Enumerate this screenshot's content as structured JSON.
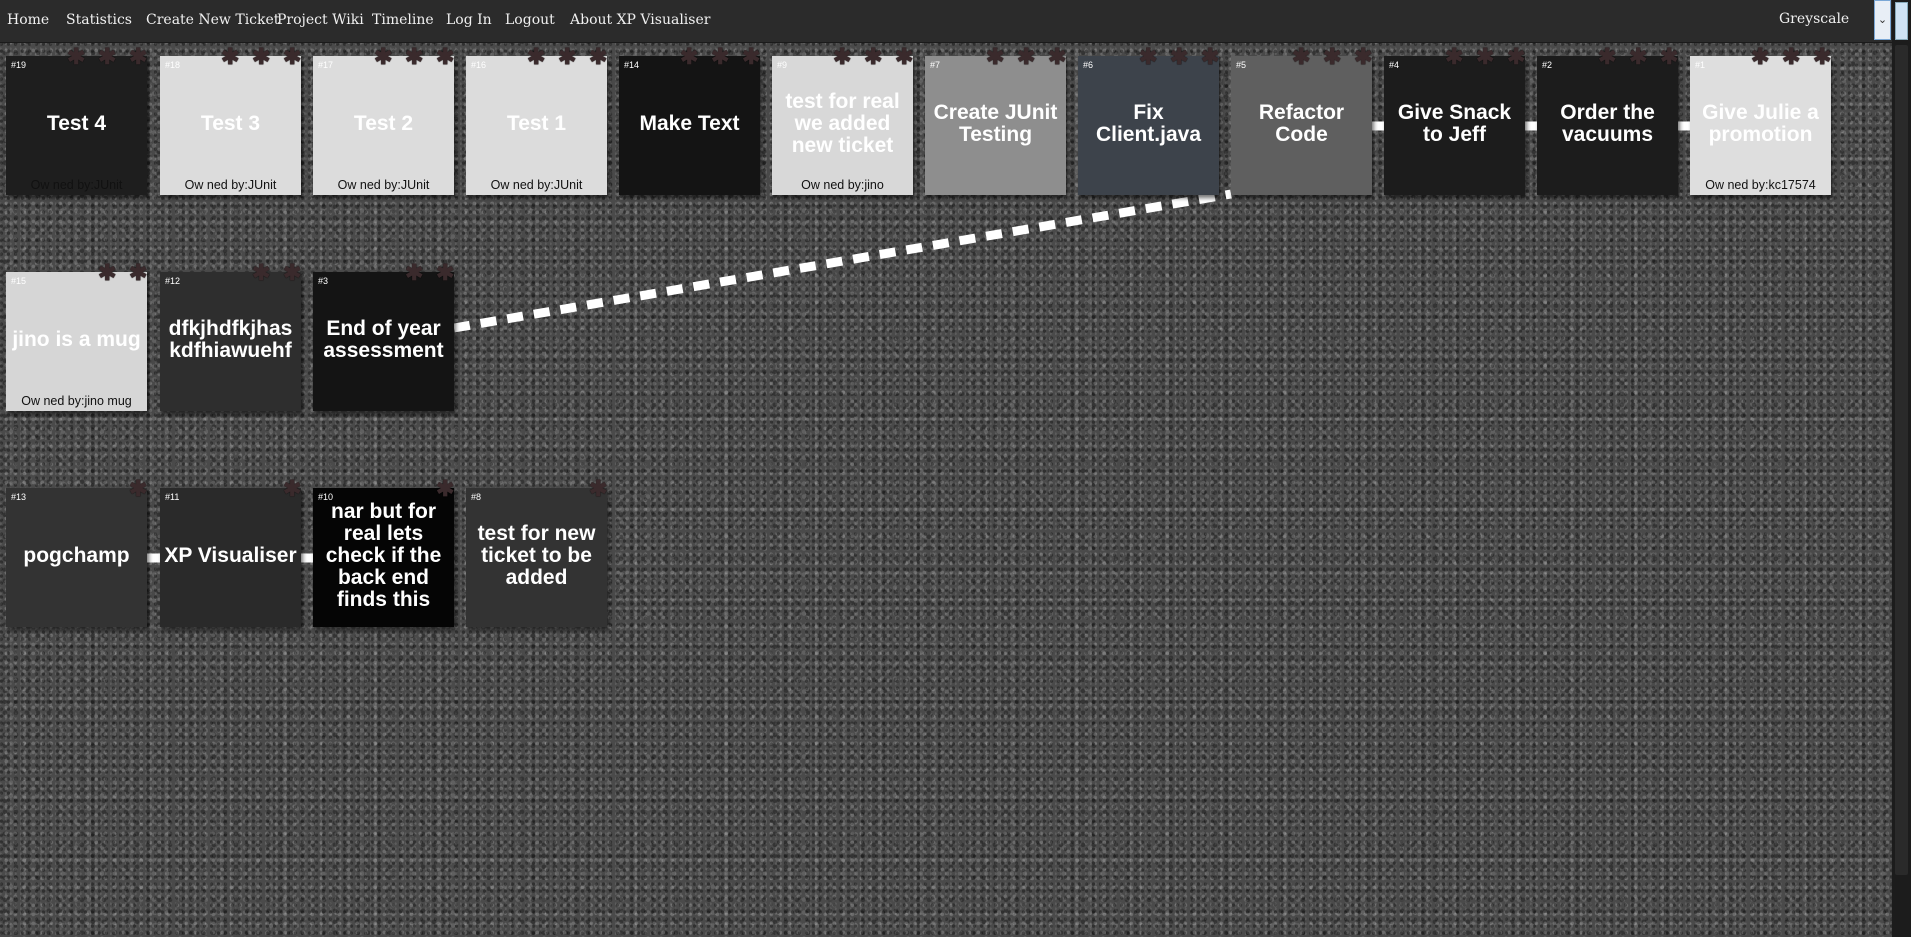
{
  "nav": {
    "items": [
      "Home",
      "Statistics",
      "Create New Ticket",
      "Project Wiki",
      "Timeline",
      "Log In",
      "Logout",
      "About XP Visualiser"
    ],
    "theme": {
      "selected": "Greyscale",
      "arrow": "⌄"
    }
  },
  "colors": {
    "navbar": "#2b2b2b",
    "link": "#ffffff",
    "pin": "#3a2a2c"
  },
  "tickets": [
    {
      "id": "#19",
      "title": "Test 4",
      "owner": "Ow ned by:JUnit",
      "color": "#1e1e1e",
      "owner_color": "#111111"
    },
    {
      "id": "#18",
      "title": "Test 3",
      "owner": "Ow ned by:JUnit",
      "color": "#dcdcdc",
      "owner_color": "#111111"
    },
    {
      "id": "#17",
      "title": "Test 2",
      "owner": "Ow ned by:JUnit",
      "color": "#dcdcdc",
      "owner_color": "#111111"
    },
    {
      "id": "#16",
      "title": "Test 1",
      "owner": "Ow ned by:JUnit",
      "color": "#dcdcdc",
      "owner_color": "#111111"
    },
    {
      "id": "#14",
      "title": "Make Text",
      "owner": "",
      "color": "#141414",
      "owner_color": "#111111"
    },
    {
      "id": "#9",
      "title": "test for real we added new ticket",
      "owner": "Ow ned by:jino",
      "color": "#d8d8d8",
      "owner_color": "#111111"
    },
    {
      "id": "#7",
      "title": "Create JUnit Testing",
      "owner": "",
      "color": "#8e8e8e",
      "owner_color": "#111111"
    },
    {
      "id": "#6",
      "title": "Fix Client.java",
      "owner": "",
      "color": "#3d434b",
      "owner_color": "#111111"
    },
    {
      "id": "#5",
      "title": "Refactor Code",
      "owner": "",
      "color": "#5f5f5f",
      "owner_color": "#111111"
    },
    {
      "id": "#4",
      "title": "Give Snack to Jeff",
      "owner": "",
      "color": "#1c1c1c",
      "owner_color": "#111111"
    },
    {
      "id": "#2",
      "title": "Order the vacuums",
      "owner": "",
      "color": "#1c1c1c",
      "owner_color": "#111111"
    },
    {
      "id": "#1",
      "title": "Give Julie a promotion",
      "owner": "Ow ned by:kc17574",
      "color": "#dedede",
      "owner_color": "#111111"
    },
    {
      "id": "#15",
      "title": "jino is a mug",
      "owner": "Ow ned by:jino mug",
      "color": "#d6d6d6",
      "owner_color": "#111111"
    },
    {
      "id": "#12",
      "title": "dfkjhdfkjhaskdfhiawuehf",
      "owner": "",
      "color": "#2e2e2e",
      "owner_color": "#111111"
    },
    {
      "id": "#3",
      "title": "End of year assessment",
      "owner": "",
      "color": "#141414",
      "owner_color": "#111111"
    },
    {
      "id": "#13",
      "title": "pogchamp",
      "owner": "",
      "color": "#333333",
      "owner_color": "#111111"
    },
    {
      "id": "#11",
      "title": "XP Visualiser",
      "owner": "",
      "color": "#2a2a2a",
      "owner_color": "#111111"
    },
    {
      "id": "#10",
      "title": "nar but for real lets check if the back end finds this",
      "owner": "",
      "color": "#050505",
      "owner_color": "#111111"
    },
    {
      "id": "#8",
      "title": "test for new ticket to be added",
      "owner": "",
      "color": "#333333",
      "owner_color": "#111111"
    }
  ],
  "links": [
    {
      "from": "#3",
      "to": "#5"
    },
    {
      "from": "#5",
      "to": "#4"
    },
    {
      "from": "#4",
      "to": "#2"
    },
    {
      "from": "#2",
      "to": "#1"
    },
    {
      "from": "#13",
      "to": "#11"
    },
    {
      "from": "#11",
      "to": "#10"
    }
  ]
}
